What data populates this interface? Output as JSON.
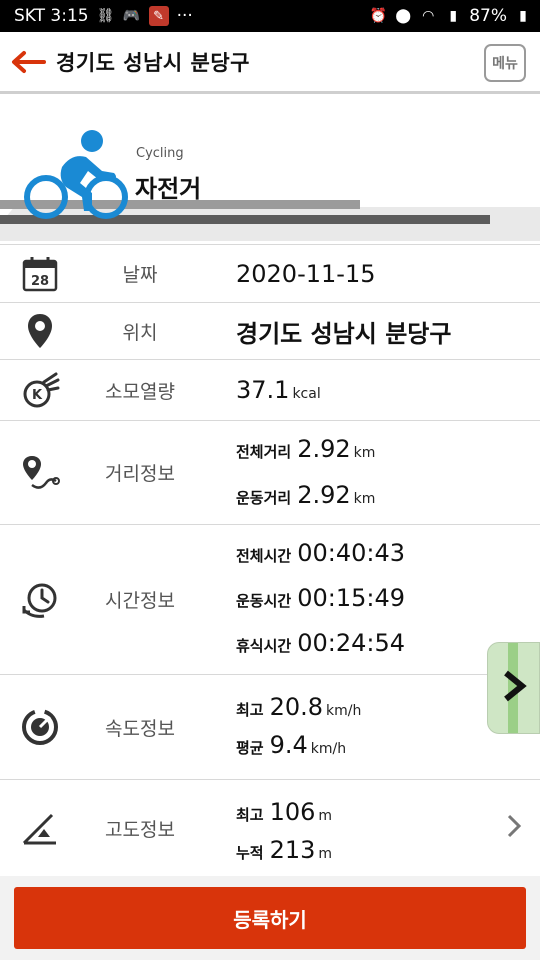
{
  "status": {
    "carrier_time": "SKT 3:15",
    "more": "···",
    "battery": "87%"
  },
  "header": {
    "title": "경기도 성남시 분당구",
    "menu_label": "메뉴"
  },
  "activity": {
    "sport_en": "Cycling",
    "sport_ko": "자전거",
    "accent_color": "#1a8ad4"
  },
  "rows": {
    "date": {
      "label": "날짜",
      "value": "2020-11-15",
      "calendar_day": "28"
    },
    "location": {
      "label": "위치",
      "value": "경기도 성남시 분당구"
    },
    "calories": {
      "label": "소모열량",
      "value": "37.1",
      "unit": "kcal"
    },
    "distance": {
      "label": "거리정보",
      "total_label": "전체거리",
      "total_value": "2.92",
      "total_unit": "km",
      "move_label": "운동거리",
      "move_value": "2.92",
      "move_unit": "km"
    },
    "time": {
      "label": "시간정보",
      "total_label": "전체시간",
      "total_value": "00:40:43",
      "move_label": "운동시간",
      "move_value": "00:15:49",
      "rest_label": "휴식시간",
      "rest_value": "00:24:54"
    },
    "speed": {
      "label": "속도정보",
      "max_label": "최고",
      "max_value": "20.8",
      "max_unit": "km/h",
      "avg_label": "평균",
      "avg_value": "9.4",
      "avg_unit": "km/h"
    },
    "altitude": {
      "label": "고도정보",
      "max_label": "최고",
      "max_value": "106",
      "max_unit": "m",
      "cum_label": "누적",
      "cum_value": "213",
      "cum_unit": "m"
    }
  },
  "map_tab": {
    "icon": "chevron-right-icon"
  },
  "footer": {
    "register_label": "등록하기",
    "button_color": "#d8340b"
  }
}
